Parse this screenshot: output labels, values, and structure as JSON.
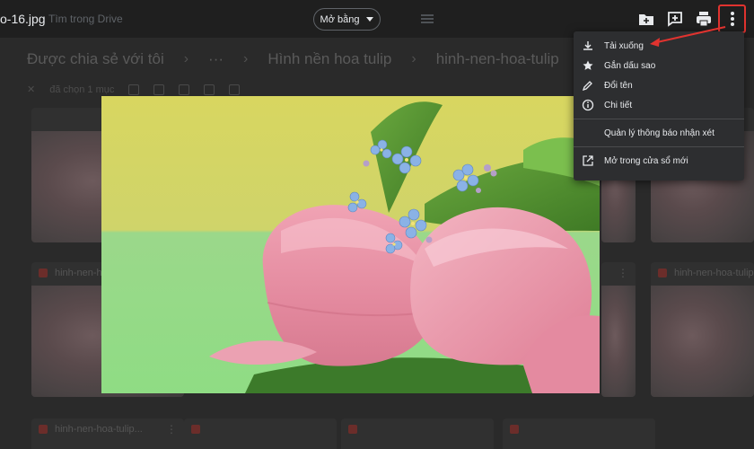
{
  "header": {
    "file_name": "o-16.jpg",
    "opened_with": "Tìm trong Drive",
    "open_with_label": "Mở bằng",
    "icons": [
      "add-to-drive-icon",
      "add-comment-icon",
      "print-icon",
      "more-vert-icon"
    ]
  },
  "background": {
    "breadcrumb": [
      "Được chia sẻ với tôi",
      "···",
      "Hình nền hoa tulip",
      "hinh-nen-hoa-tulip"
    ],
    "selection_text": "đã chọn 1 mục",
    "tile_labels": [
      "hinh-nen-hoa-tulip...",
      "hinh-nen-hoa-tulip...",
      "hinh-nen-hoa-tulip..."
    ]
  },
  "menu": {
    "items": [
      {
        "label": "Tải xuống",
        "icon": "download-icon"
      },
      {
        "label": "Gắn dấu sao",
        "icon": "star-icon"
      },
      {
        "label": "Đổi tên",
        "icon": "edit-icon"
      },
      {
        "label": "Chi tiết",
        "icon": "info-icon"
      },
      {
        "label": "Quản lý thông báo nhận xét",
        "icon": ""
      },
      {
        "label": "Mở trong cửa sổ mới",
        "icon": "open-new-window-icon"
      }
    ]
  },
  "colors": {
    "highlight": "#e0332f",
    "menu_bg": "#2d2e30",
    "topbar_bg": "#1f1f1f"
  }
}
